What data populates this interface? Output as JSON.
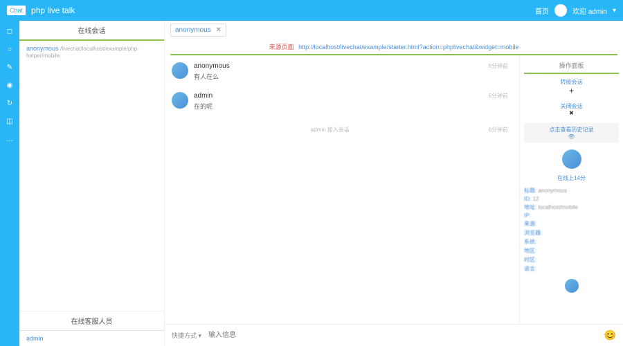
{
  "header": {
    "logo": "Chat",
    "title": "php live talk",
    "nav_home": "首页",
    "welcome": "欢迎 admin",
    "caret": "▾"
  },
  "iconbar": {
    "items": [
      "◻",
      "○",
      "✎",
      "◉",
      "↻",
      "◫",
      "…"
    ]
  },
  "left": {
    "active_title": "在线会话",
    "conv_name": "anonymous",
    "conv_sub": "/livechat/localhost/example/php-helper/mobile",
    "agents_title": "在线客服人员",
    "agent_name": "admin"
  },
  "tab": {
    "label": "anonymous",
    "close": "✕"
  },
  "urlbar": {
    "label": "来源页面",
    "url": "http://localhost/livechat/example/starter.html?action=phplivechat&widget=mobile"
  },
  "messages": [
    {
      "name": "anonymous",
      "text": "有人在么",
      "time": "6分钟前"
    },
    {
      "name": "admin",
      "text": "在的呢",
      "time": "6分钟前"
    }
  ],
  "sysmsg": {
    "text": "admin 加入会话",
    "time": "6分钟前"
  },
  "side": {
    "title": "操作面板",
    "transfer": "转接会话",
    "close": "关闭会话",
    "history": "点击查看历史记录",
    "eye": "👁",
    "status": "在线上14分",
    "rows": [
      {
        "l": "标题",
        "v": "anonymous"
      },
      {
        "l": "ID",
        "v": "12"
      },
      {
        "l": "地址",
        "v": "localhost/mobile"
      },
      {
        "l": "IP",
        "v": ""
      },
      {
        "l": "来源",
        "v": ""
      },
      {
        "l": "浏览器",
        "v": ""
      },
      {
        "l": "系统",
        "v": ""
      },
      {
        "l": "地区",
        "v": ""
      },
      {
        "l": "时区",
        "v": ""
      },
      {
        "l": "语言",
        "v": ""
      }
    ]
  },
  "input": {
    "tools": "快捷方式 ▾",
    "placeholder": "输入信息",
    "emoji": "😊"
  }
}
